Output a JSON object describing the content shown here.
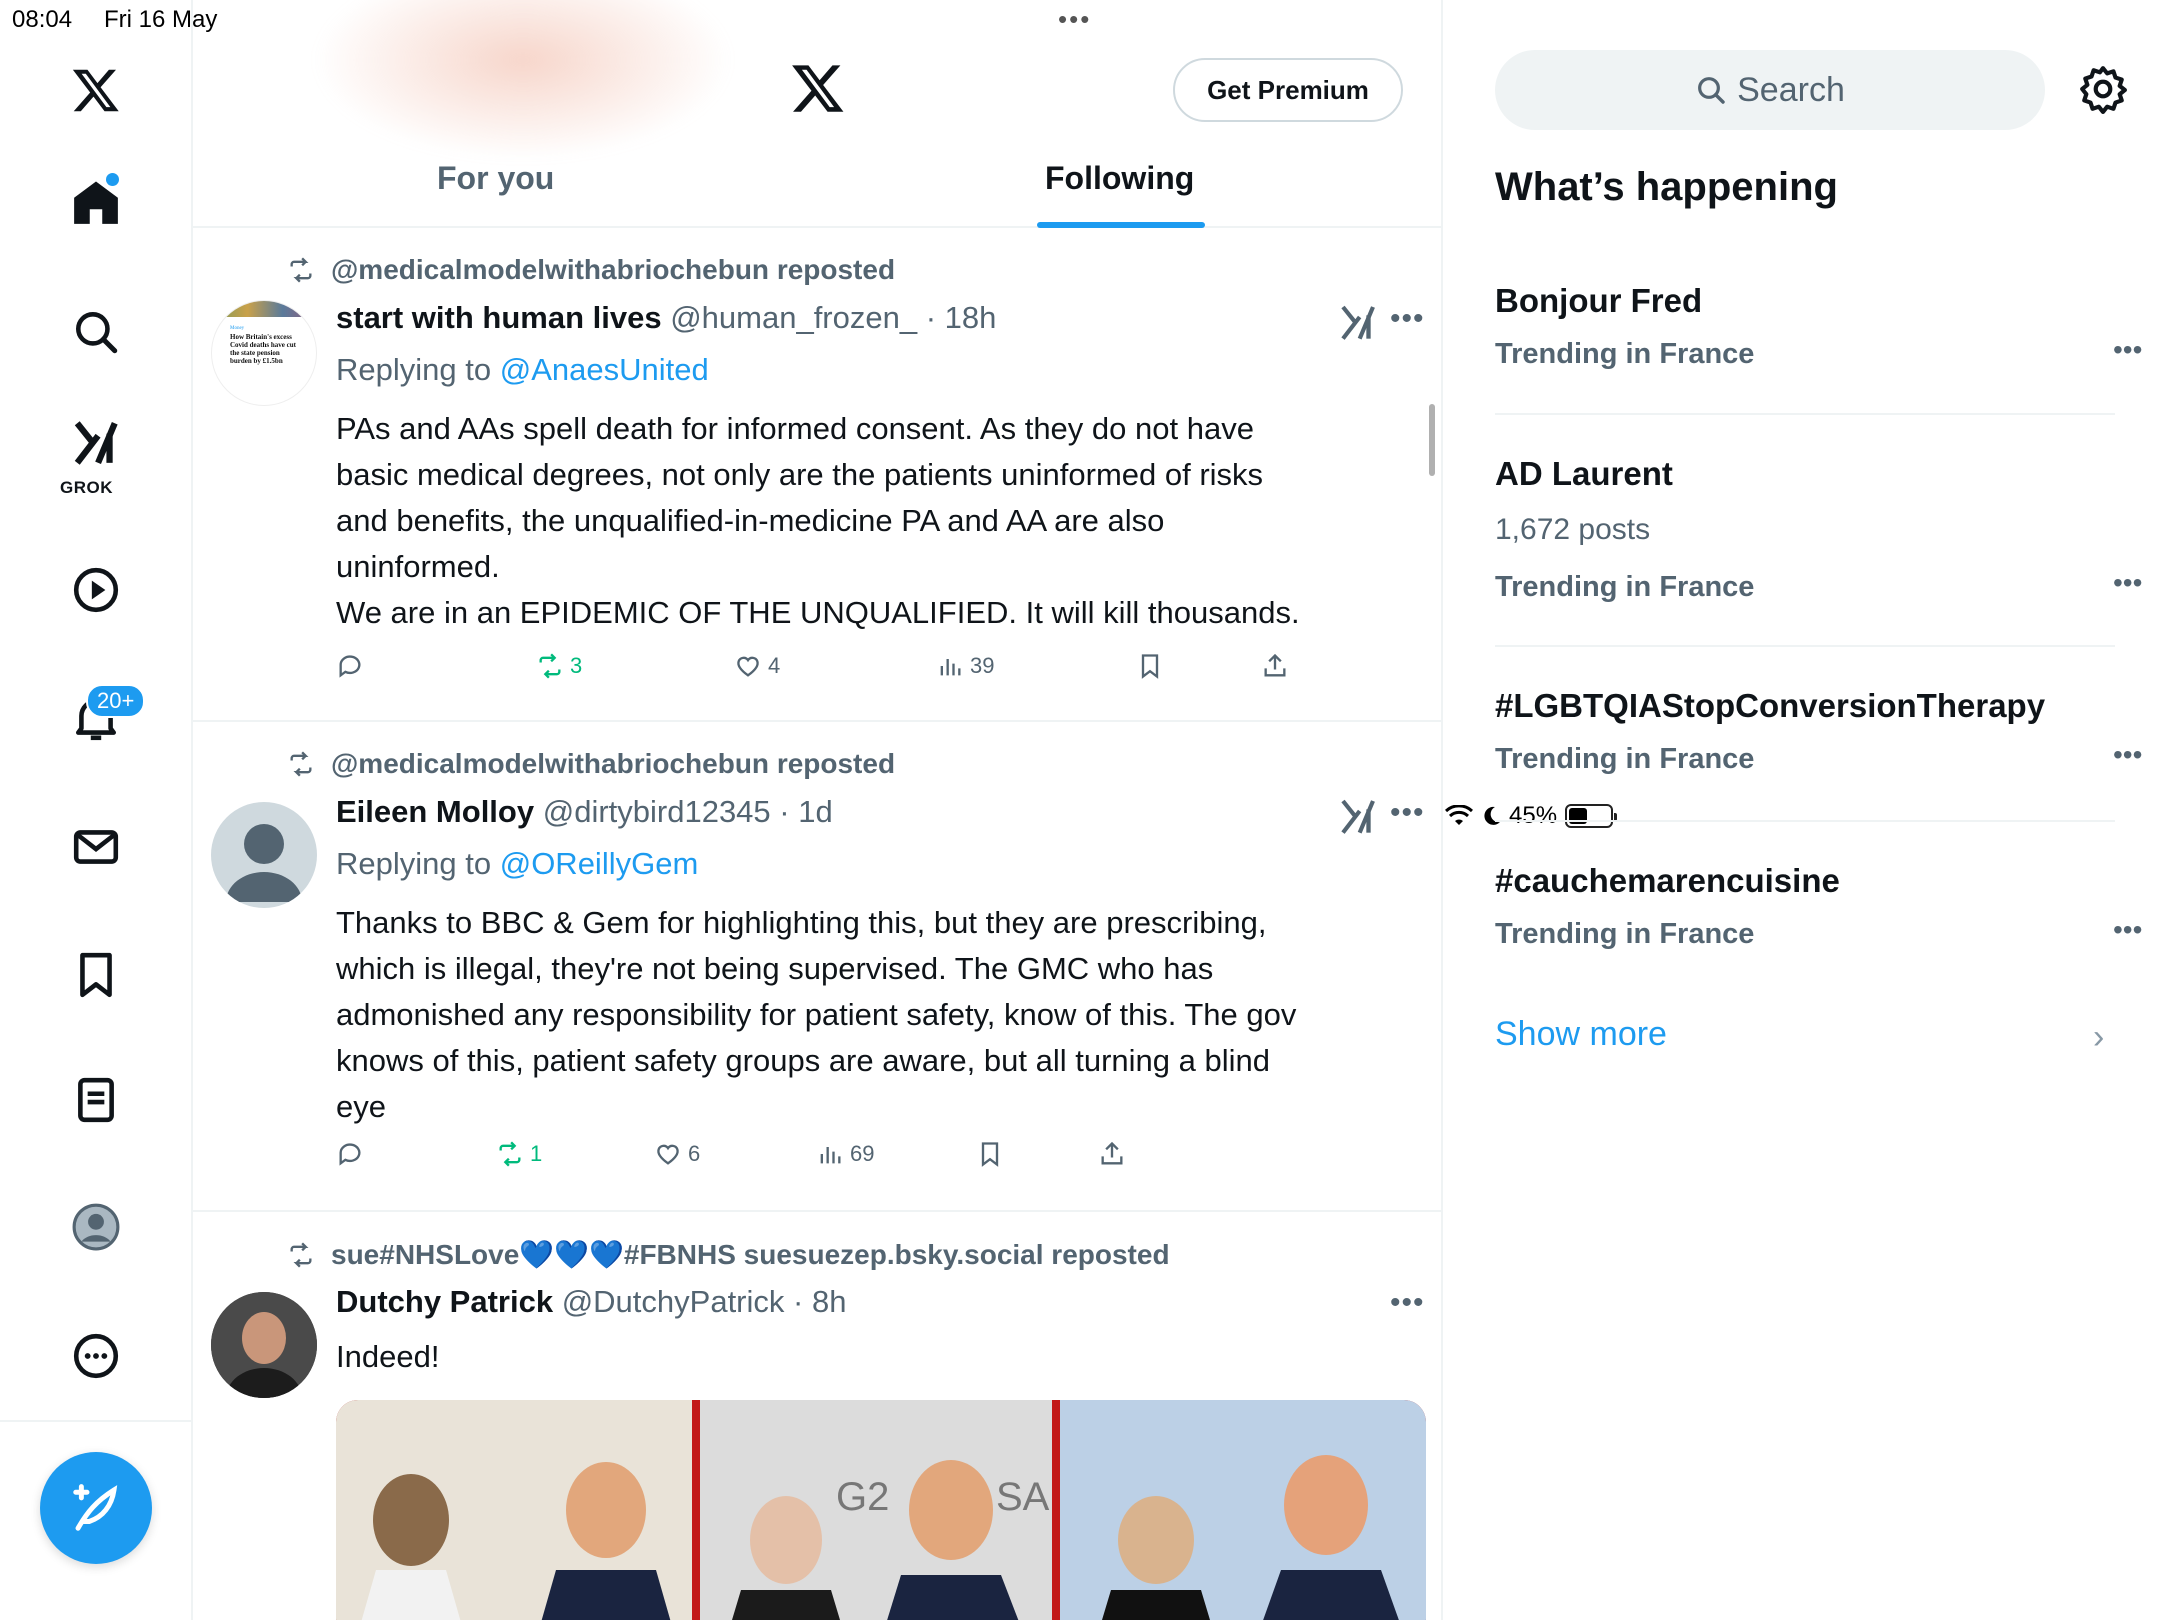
{
  "status_bar": {
    "time": "08:04",
    "date": "Fri 16 May",
    "battery": "45%",
    "battery_level": 0.45
  },
  "nav": {
    "grok_label": "GROK",
    "notifications_badge": "20+"
  },
  "header": {
    "premium_label": "Get Premium",
    "tabs": [
      {
        "label": "For you",
        "active": false
      },
      {
        "label": "Following",
        "active": true
      }
    ]
  },
  "posts": [
    {
      "repost_by": "@medicalmodelwithabriochebun reposted",
      "name": "start with human lives",
      "handle": "@human_frozen_",
      "time": "· 18h",
      "reply_prefix": "Replying to ",
      "reply_to": "@AnaesUnited",
      "body": [
        "PAs and AAs spell death for informed consent.  As they do not have",
        "basic medical degrees, not only are the patients uninformed of risks",
        "and benefits, the unqualified-in-medicine PA and AA are also",
        "uninformed.",
        "We are in an EPIDEMIC OF THE UNQUALIFIED. It will kill thousands."
      ],
      "avatar_text": [
        "Money",
        "How Britain's excess",
        "Covid deaths have cut",
        "the state pension",
        "burden by £1.5bn"
      ],
      "reposts": "3",
      "likes": "4",
      "views": "39"
    },
    {
      "repost_by": "@medicalmodelwithabriochebun reposted",
      "name": "Eileen Molloy",
      "handle": "@dirtybird12345",
      "time": "· 1d",
      "reply_prefix": "Replying to ",
      "reply_to": "@OReillyGem",
      "body": [
        "Thanks to BBC & Gem for highlighting this, but they are prescribing,",
        "which is illegal, they're not being supervised. The GMC who has",
        "admonished any responsibility for patient safety, know of this. The gov",
        "knows of this, patient safety groups are aware, but all turning a blind",
        "eye"
      ],
      "reposts": "1",
      "likes": "6",
      "views": "69"
    },
    {
      "repost_by": "sue#NHSLove💙💙💙#FBNHS suesuezep.bsky.social reposted",
      "name": "Dutchy Patrick",
      "handle": "@DutchyPatrick",
      "time": "· 8h",
      "body": [
        "Indeed!"
      ],
      "image_text": [
        "G2",
        "SA"
      ]
    }
  ],
  "sidebar": {
    "search_placeholder": "Search",
    "section_title": "What’s happening",
    "trends": [
      {
        "name": "Bonjour Fred",
        "posts": "",
        "context": "Trending in France"
      },
      {
        "name": "AD Laurent",
        "posts": "1,672 posts",
        "context": "Trending in France"
      },
      {
        "name": "#LGBTQIAStopConversionTherapy",
        "posts": "",
        "context": "Trending in France"
      },
      {
        "name": "#cauchemarencuisine",
        "posts": "",
        "context": "Trending in France"
      }
    ],
    "show_more": "Show more"
  },
  "colors": {
    "accent": "#1d9bf0",
    "repost_green": "#00ba7c",
    "muted": "#536471"
  }
}
